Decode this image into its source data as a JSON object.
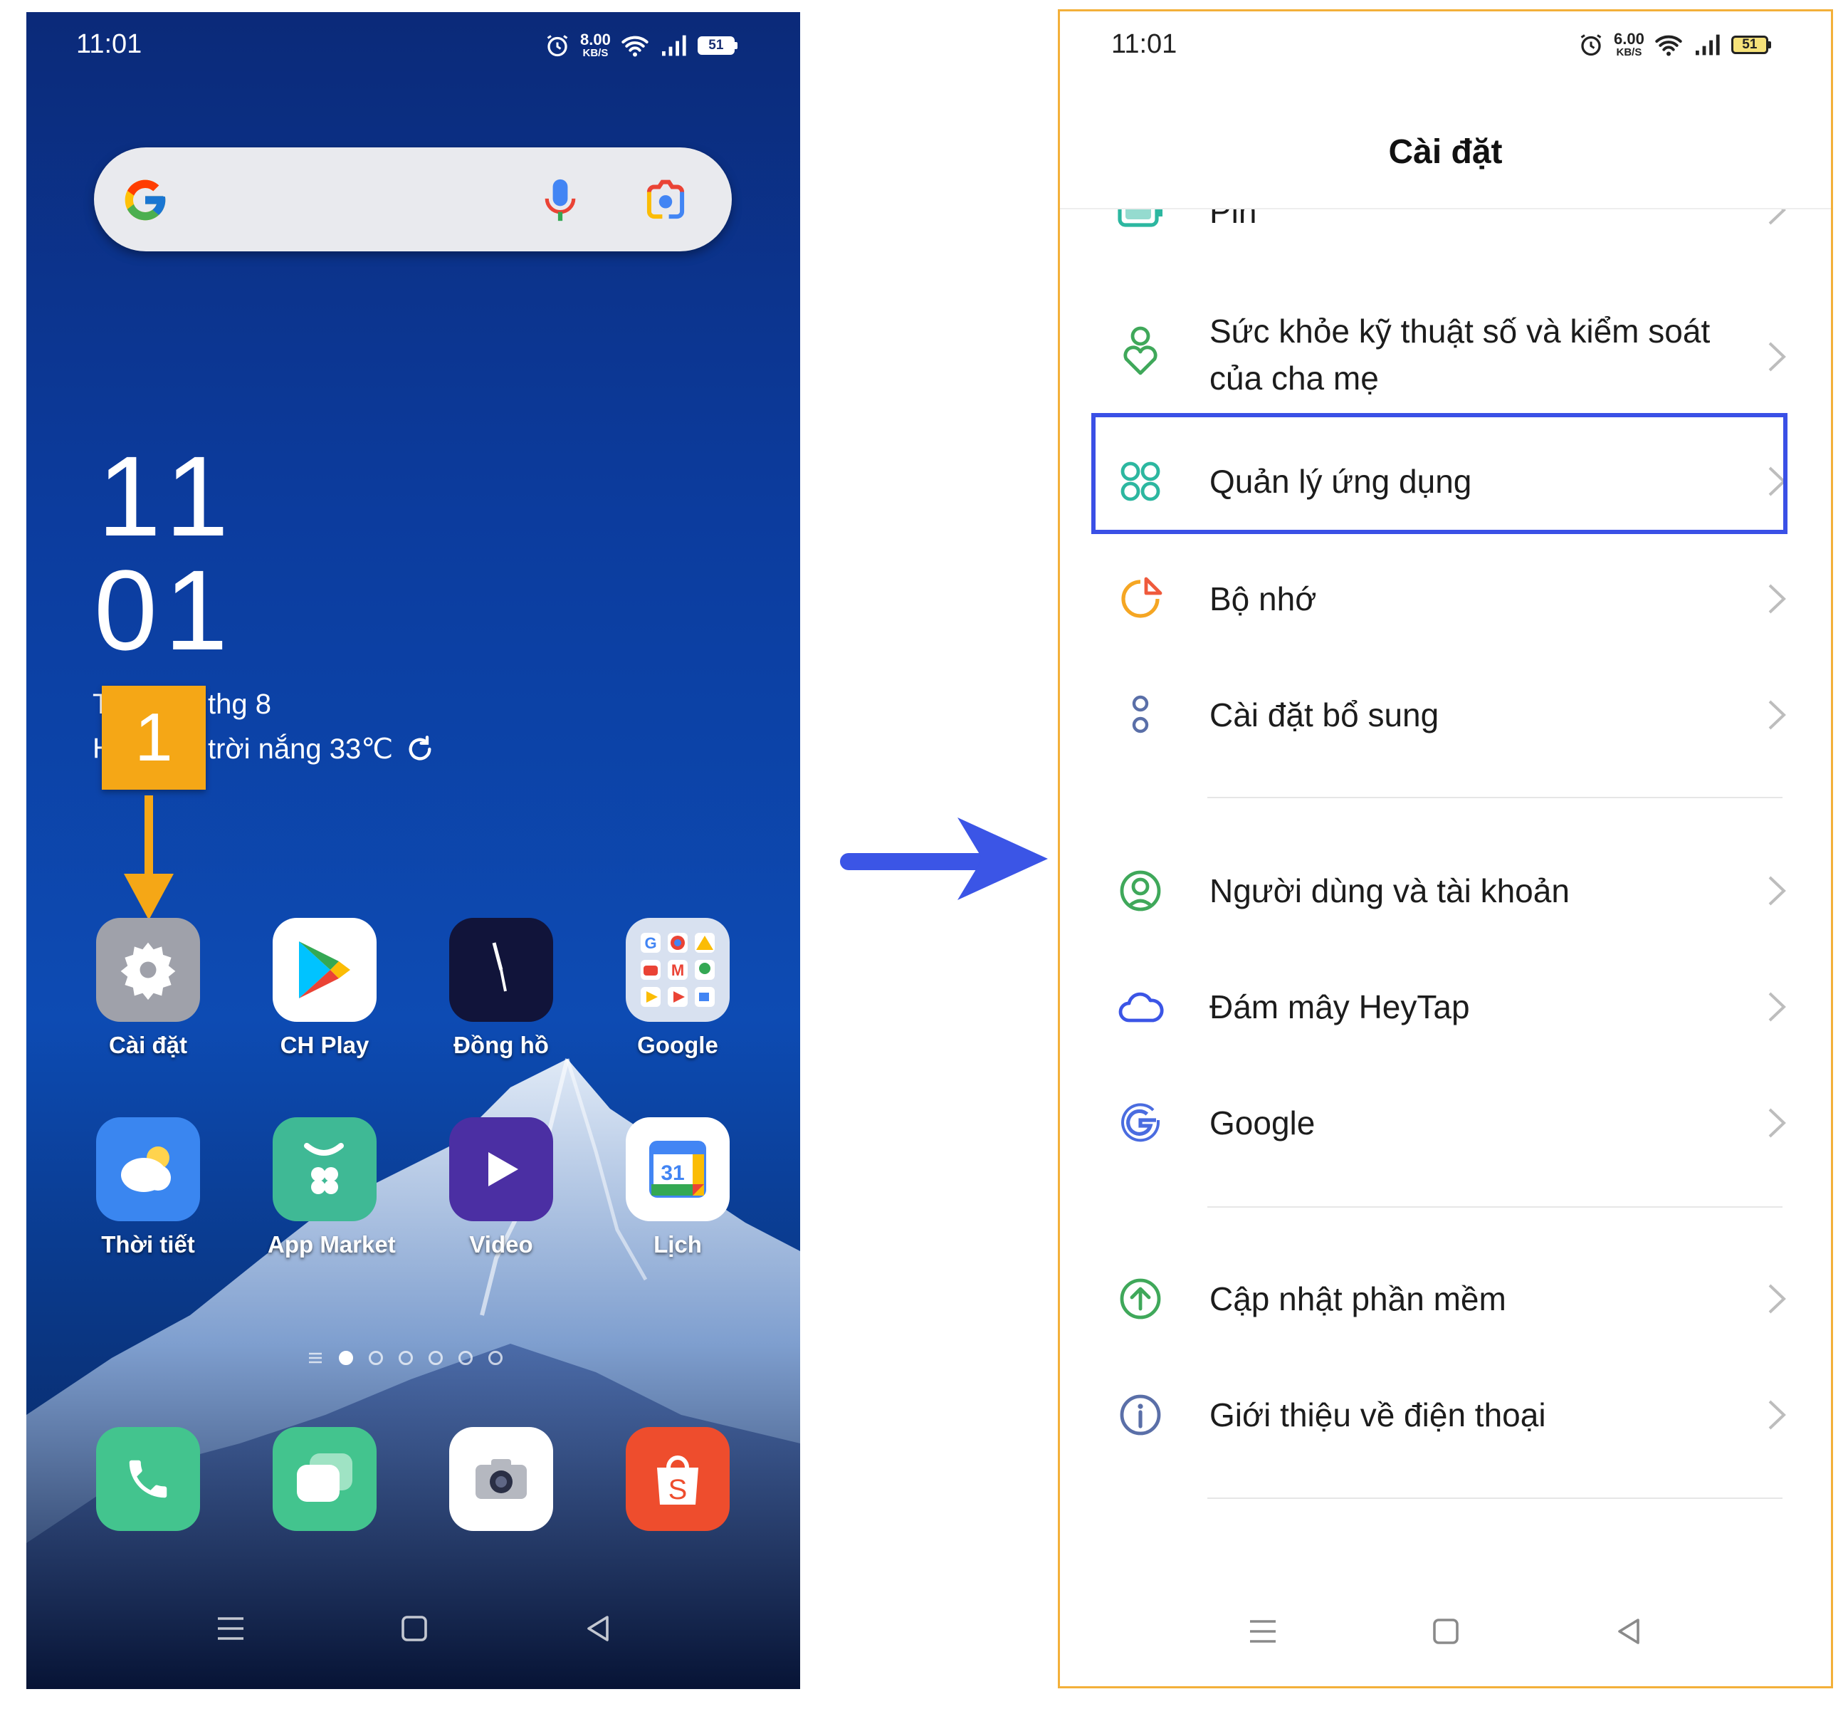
{
  "home_screen": {
    "status_bar": {
      "time": "11:01",
      "speed_value": "8.00",
      "speed_unit": "KB/S",
      "battery": "51"
    },
    "clock_hour": "11",
    "clock_minute": "01",
    "date_prefix": "T",
    "date": "thg 8",
    "weather_prefix": "H",
    "weather": "trời nắng 33℃",
    "step_badge": "1",
    "apps_row1": [
      {
        "label": "Cài đặt",
        "icon": "settings-gear-icon"
      },
      {
        "label": "CH Play",
        "icon": "play-store-icon"
      },
      {
        "label": "Đồng hồ",
        "icon": "clock-icon"
      },
      {
        "label": "Google",
        "icon": "google-folder-icon"
      }
    ],
    "apps_row2": [
      {
        "label": "Thời tiết",
        "icon": "weather-icon"
      },
      {
        "label": "App Market",
        "icon": "app-market-icon"
      },
      {
        "label": "Video",
        "icon": "video-play-icon"
      },
      {
        "label": "Lịch",
        "icon": "calendar-icon"
      }
    ],
    "calendar_day": "31",
    "dock": [
      {
        "icon": "phone-icon"
      },
      {
        "icon": "messages-icon"
      },
      {
        "icon": "camera-icon"
      },
      {
        "icon": "shopee-icon"
      }
    ]
  },
  "settings_screen": {
    "status_bar": {
      "time": "11:01",
      "speed_value": "6.00",
      "speed_unit": "KB/S",
      "battery": "51"
    },
    "title": "Cài đặt",
    "items": [
      {
        "label": "Pin",
        "icon": "battery-icon"
      },
      {
        "label_line1": "Sức khỏe kỹ thuật số và kiểm soát",
        "label_line2": "của cha mẹ",
        "icon": "digital-wellbeing-icon"
      },
      {
        "label": "Quản lý ứng dụng",
        "icon": "app-management-icon",
        "highlighted": true
      },
      {
        "label": "Bộ nhớ",
        "icon": "storage-pie-icon"
      },
      {
        "label": "Cài đặt bổ sung",
        "icon": "additional-settings-icon"
      },
      {
        "label": "Người dùng và tài khoản",
        "icon": "users-accounts-icon"
      },
      {
        "label": "Đám mây HeyTap",
        "icon": "cloud-icon"
      },
      {
        "label": "Google",
        "icon": "google-g-icon"
      },
      {
        "label": "Cập nhật phần mềm",
        "icon": "software-update-icon"
      },
      {
        "label": "Giới thiệu về điện thoại",
        "icon": "about-phone-icon"
      }
    ]
  },
  "colors": {
    "step_badge": "#f5a716",
    "highlight_box": "#3a50e6",
    "transition_arrow": "#3b55e6",
    "settings_border": "#f3b03a",
    "teal_icon": "#2cb7a0"
  }
}
